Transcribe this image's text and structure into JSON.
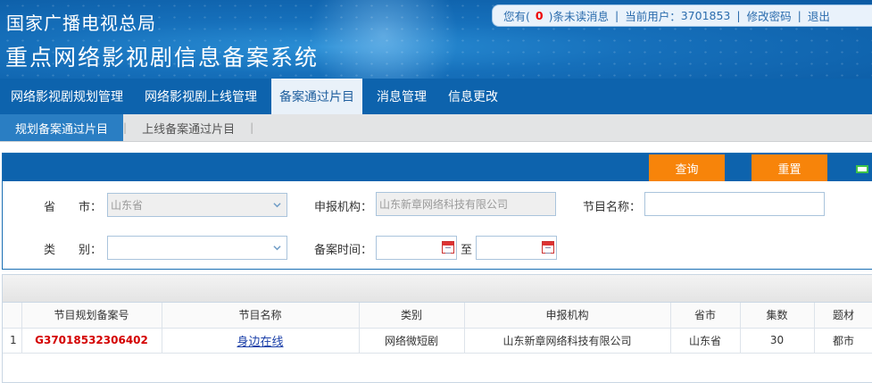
{
  "header": {
    "org_name": "国家广播电视总局",
    "system_title": "重点网络影视剧信息备案系统"
  },
  "userbar": {
    "unread_prefix": "您有(",
    "unread_count": "0",
    "unread_suffix": ")条未读消息",
    "user_prefix": "当前用户：",
    "user_id": "3701853",
    "change_password": "修改密码",
    "logout": "退出"
  },
  "main_nav": {
    "items": [
      "网络影视剧规划管理",
      "网络影视剧上线管理",
      "备案通过片目",
      "消息管理",
      "信息更改"
    ],
    "active": "备案通过片目"
  },
  "sub_nav": {
    "items": [
      "规划备案通过片目",
      "上线备案通过片目"
    ],
    "active": "规划备案通过片目"
  },
  "query": {
    "query_button": "查询",
    "reset_button": "重置",
    "province_label": "省　　市：",
    "province_value": "山东省",
    "agency_label": "申报机构：",
    "agency_value": "山东新章网络科技有限公司",
    "program_name_label": "节目名称：",
    "program_name_value": "",
    "category_label": "类　　别：",
    "category_value": "",
    "record_time_label": "备案时间：",
    "record_time_from": "",
    "record_time_sep": "至",
    "record_time_to": ""
  },
  "grid": {
    "columns": [
      "节目规划备案号",
      "节目名称",
      "类别",
      "申报机构",
      "省市",
      "集数",
      "题材"
    ],
    "rows": [
      {
        "index": "1",
        "code": "G37018532306402",
        "name": "身边在线",
        "category": "网络微短剧",
        "agency": "山东新章网络科技有限公司",
        "province": "山东省",
        "episodes": "30",
        "theme": "都市"
      }
    ]
  },
  "colors": {
    "banner_blue": "#0d63ad",
    "active_subtab": "#2a7ec3",
    "button_orange": "#f7840a",
    "code_red": "#d40000"
  }
}
